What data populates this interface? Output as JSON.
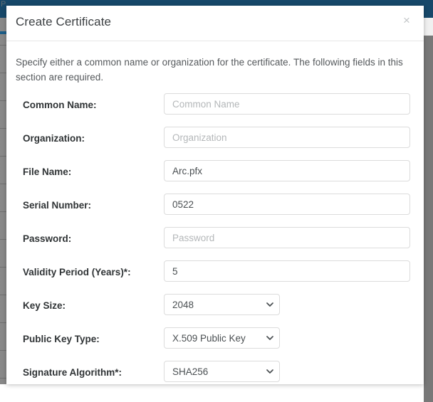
{
  "backdrop": {
    "ghost_letter": "P",
    "navy_color": "#17486a",
    "scrollbar_color": "#787878"
  },
  "modal": {
    "title": "Create Certificate",
    "close_label": "×",
    "close_icon": "close-icon",
    "description": "Specify either a common name or organization for the certificate. The following fields in this section are required.",
    "fields": [
      {
        "id": "common-name",
        "label": "Common Name:",
        "type": "text",
        "value": "",
        "placeholder": "Common Name"
      },
      {
        "id": "organization",
        "label": "Organization:",
        "type": "text",
        "value": "",
        "placeholder": "Organization"
      },
      {
        "id": "file-name",
        "label": "File Name:",
        "type": "text",
        "value": "Arc.pfx",
        "placeholder": ""
      },
      {
        "id": "serial-number",
        "label": "Serial Number:",
        "type": "text",
        "value": "0522",
        "placeholder": ""
      },
      {
        "id": "password",
        "label": "Password:",
        "type": "text",
        "value": "",
        "placeholder": "Password"
      },
      {
        "id": "validity-period",
        "label": "Validity Period (Years)*:",
        "type": "text",
        "value": "5",
        "placeholder": ""
      },
      {
        "id": "key-size",
        "label": "Key Size:",
        "type": "select",
        "value": "2048",
        "options": [
          "2048"
        ]
      },
      {
        "id": "public-key-type",
        "label": "Public Key Type:",
        "type": "select",
        "value": "X.509 Public Key",
        "options": [
          "X.509 Public Key"
        ]
      },
      {
        "id": "signature-algorithm",
        "label": "Signature Algorithm*:",
        "type": "select",
        "value": "SHA256",
        "options": [
          "SHA256"
        ]
      }
    ]
  }
}
